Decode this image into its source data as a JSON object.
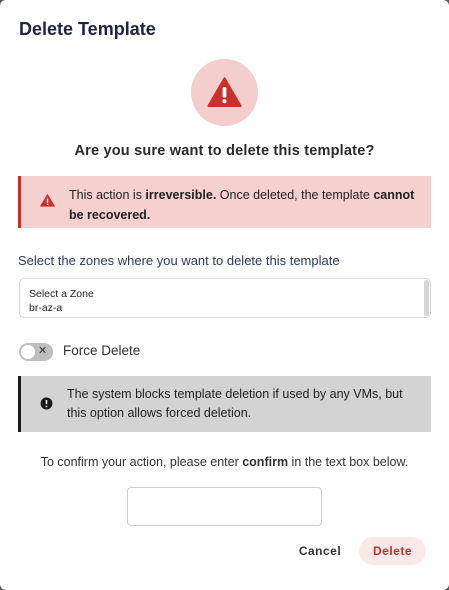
{
  "dialog": {
    "title": "Delete Template",
    "question": "Are you sure want to delete this template?"
  },
  "danger_alert": {
    "prefix": "This action is ",
    "bold1": "irreversible.",
    "middle": " Once deleted, the template ",
    "bold2": "cannot be recovered."
  },
  "zones": {
    "label": "Select the zones where you want to delete this template",
    "placeholder": "Select a Zone",
    "options": [
      "br-az-a"
    ]
  },
  "force_delete": {
    "label": "Force Delete",
    "enabled": false,
    "off_glyph": "✕"
  },
  "info_alert": {
    "text": "The system blocks template deletion if used by any VMs, but this option allows forced deletion."
  },
  "confirm": {
    "prefix": "To confirm your action, please enter ",
    "keyword": "confirm",
    "suffix": " in the text box below.",
    "value": "",
    "placeholder": ""
  },
  "buttons": {
    "cancel": "Cancel",
    "delete": "Delete"
  },
  "colors": {
    "danger": "#c9302c",
    "danger_bg": "#f6cfcf",
    "warn_circle_bg": "#f4cdcd",
    "info_bg": "#d3d3d3",
    "title": "#1f2444"
  },
  "icons": {
    "header": "warning-triangle-icon",
    "danger_alert": "warning-triangle-icon",
    "info_alert": "exclamation-circle-icon"
  }
}
